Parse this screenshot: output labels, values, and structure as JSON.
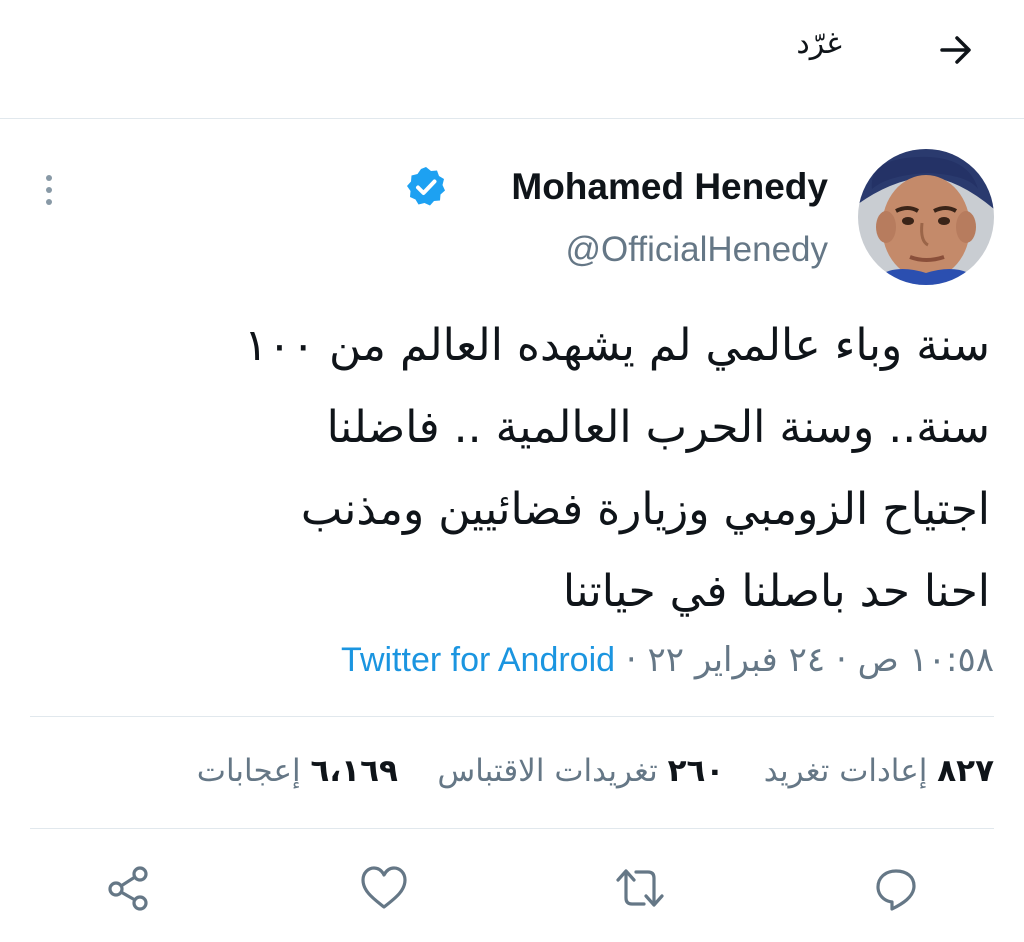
{
  "header": {
    "title": "غرّد",
    "back_icon": "arrow-right-icon"
  },
  "author": {
    "display_name": "Mohamed Henedy",
    "handle": "@OfficialHenedy",
    "verified_icon": "verified-badge-icon",
    "avatar_icon": "profile-photo"
  },
  "more_icon": "more-vertical-icon",
  "tweet": {
    "lines": [
      "سنة وباء عالمي لم يشهده العالم من ١٠٠",
      "سنة.. وسنة الحرب العالمية .. فاضلنا",
      "اجتياح الزومبي  وزيارة فضائيين ومذنب",
      "احنا حد باصلنا في حياتنا"
    ]
  },
  "meta": {
    "time": "١٠:٥٨ ص",
    "date": "٢٤ فبراير ٢٢",
    "separator": "·",
    "source": "Twitter for Android"
  },
  "stats": {
    "retweets_count": "٨٢٧",
    "retweets_label": "إعادات تغريد",
    "quotes_count": "٢٦٠",
    "quotes_label": "تغريدات الاقتباس",
    "likes_count": "٦،١٦٩",
    "likes_label": "إعجابات"
  },
  "actions": {
    "reply_icon": "reply-icon",
    "retweet_icon": "retweet-icon",
    "like_icon": "heart-icon",
    "share_icon": "share-icon"
  },
  "colors": {
    "text": "#0f1419",
    "secondary": "#657786",
    "link": "#1b95e0",
    "verified": "#1da1f2",
    "divider": "#e1e8ed"
  }
}
